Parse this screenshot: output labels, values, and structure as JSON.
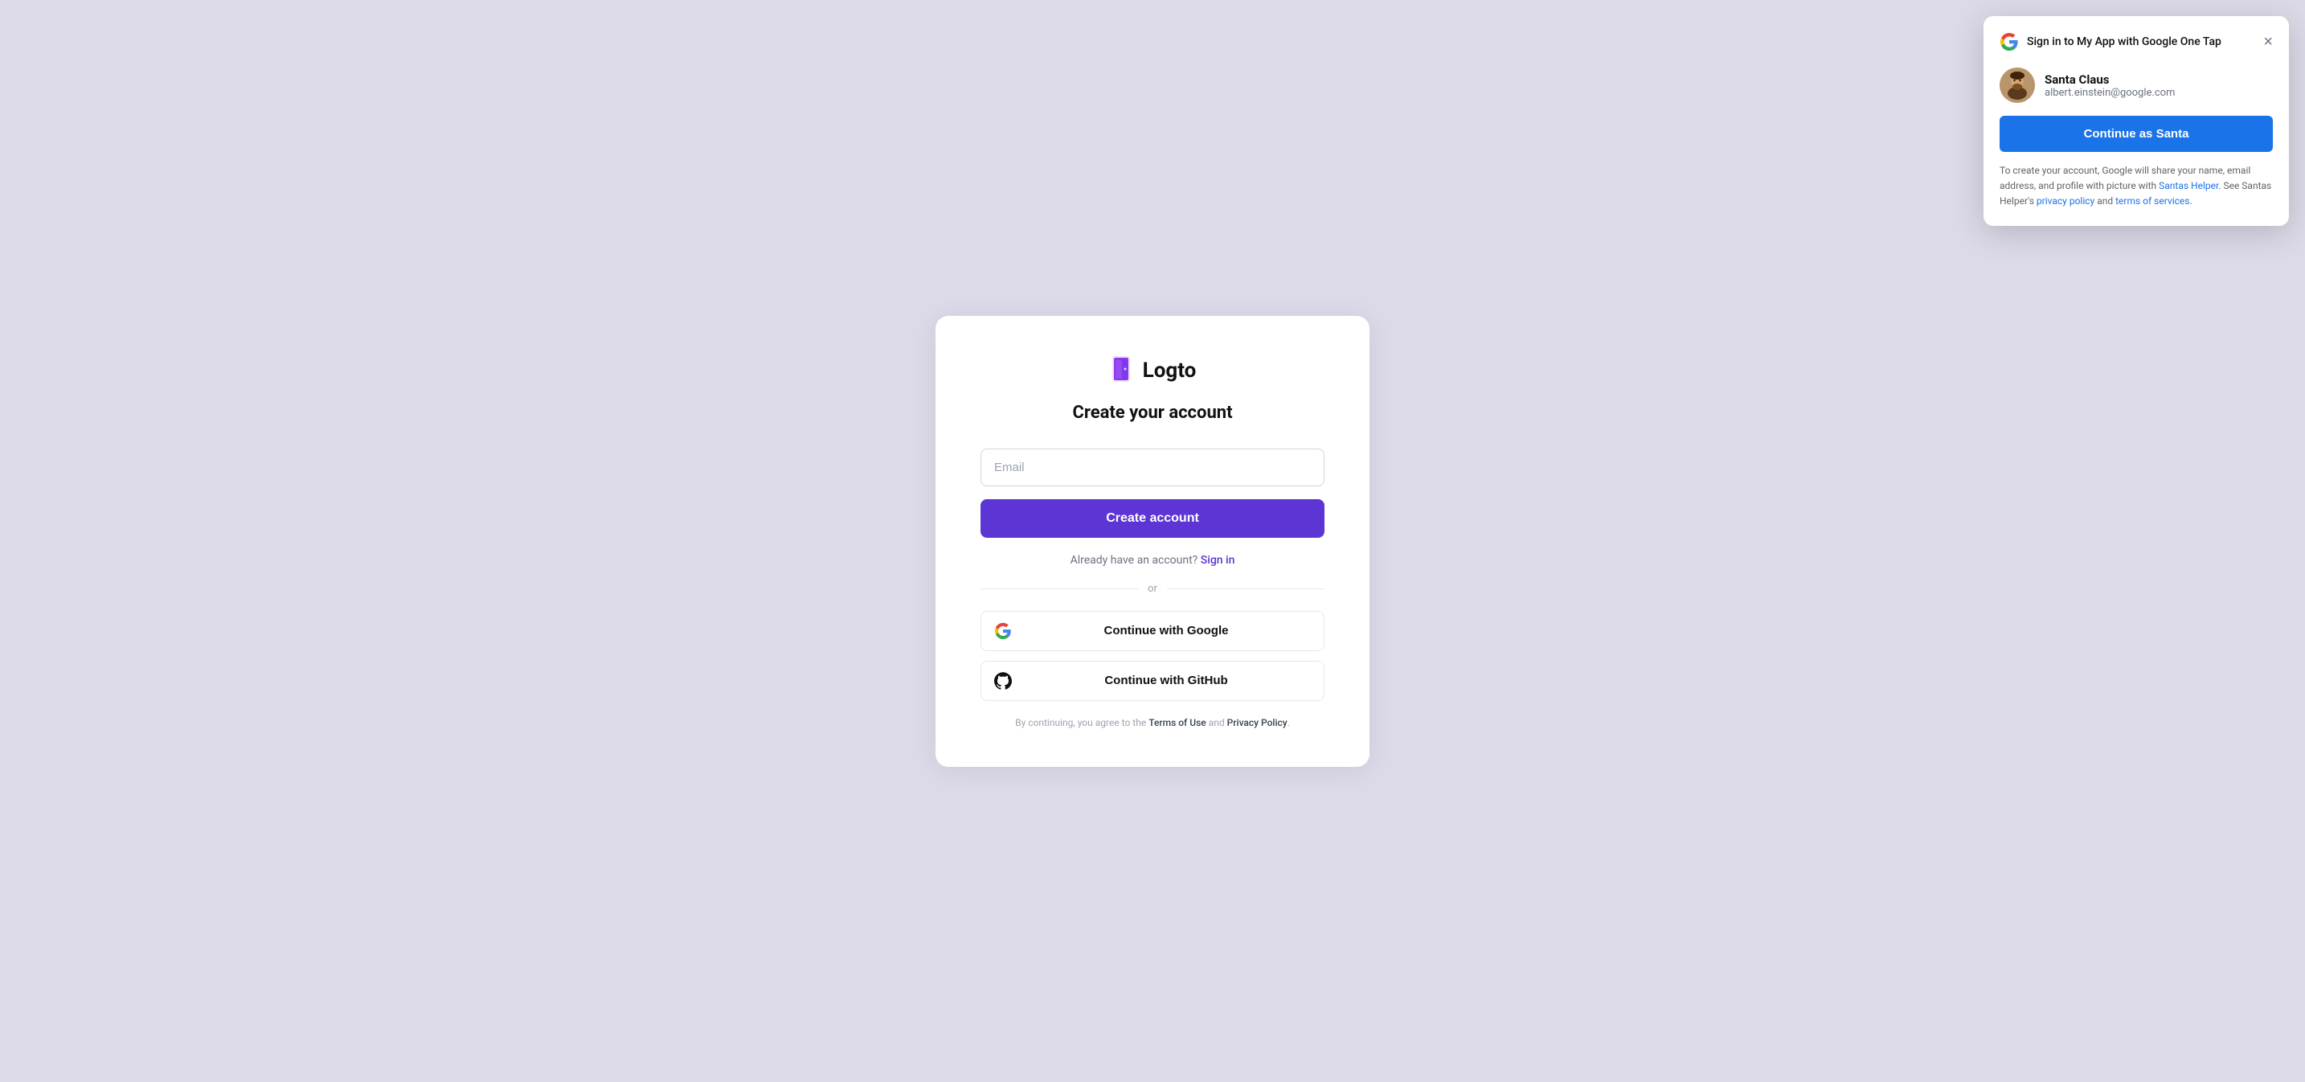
{
  "background_color": "#dcdae8",
  "main_card": {
    "logo": {
      "text": "Logto",
      "icon_alt": "Logto logo door"
    },
    "title": "Create your account",
    "email_input": {
      "placeholder": "Email",
      "value": ""
    },
    "create_account_btn": "Create account",
    "signin_prompt": "Already have an account?",
    "signin_link": "Sign in",
    "divider_text": "or",
    "google_btn": "Continue with Google",
    "github_btn": "Continue with GitHub",
    "footer": {
      "prefix": "By continuing, you agree to the",
      "terms_label": "Terms of Use",
      "and_text": "and",
      "privacy_label": "Privacy Policy",
      "suffix": "."
    }
  },
  "onetap": {
    "title": "Sign in to My App with Google One Tap",
    "close_label": "×",
    "user": {
      "name": "Santa Claus",
      "email": "albert.einstein@google.com",
      "avatar_emoji": "🧔"
    },
    "continue_btn": "Continue as Santa",
    "disclaimer_prefix": "To create your account, Google will share your name, email address, and profile with picture with",
    "app_link_text": "Santas Helper",
    "disclaimer_mid": ". See Santas Helper's",
    "privacy_link": "privacy policy",
    "and_text": "and",
    "terms_link": "terms of services",
    "disclaimer_suffix": "."
  }
}
